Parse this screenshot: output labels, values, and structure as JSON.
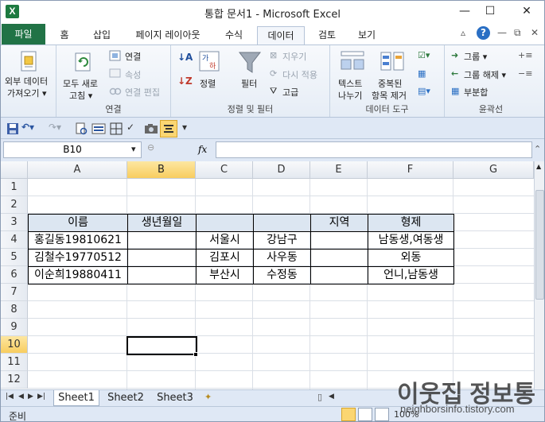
{
  "window": {
    "title": "통합 문서1  -  Microsoft Excel",
    "app_icon_letter": "X",
    "minimize": "—",
    "maximize": "☐",
    "close": "✕"
  },
  "ribbon_tabs": {
    "file": "파일",
    "items": [
      "홈",
      "삽입",
      "페이지 레이아웃",
      "수식",
      "데이터",
      "검토",
      "보기"
    ],
    "active": "데이터"
  },
  "ribbon": {
    "get_external": {
      "line1": "외부 데이터",
      "line2": "가져오기 ▾"
    },
    "refresh_all": {
      "line1": "모두 새로",
      "line2": "고침 ▾"
    },
    "connections": "연결",
    "properties": "속성",
    "edit_links": "연결 편집",
    "group_connections": "연결",
    "sort": "정렬",
    "filter": "필터",
    "clear": "지우기",
    "reapply": "다시 적용",
    "advanced": "고급",
    "group_sort_filter": "정렬 및 필터",
    "text_to_columns": {
      "line1": "텍스트",
      "line2": "나누기"
    },
    "remove_duplicates": {
      "line1": "중복된",
      "line2": "항목 제거"
    },
    "group_data_tools": "데이터 도구",
    "group": "그룹 ▾",
    "ungroup": "그룹 해제 ▾",
    "subtotal": "부분합",
    "group_outline": "윤곽선"
  },
  "formula_bar": {
    "name_box": "B10",
    "fx": "fx",
    "value": ""
  },
  "sheet": {
    "columns": [
      "A",
      "B",
      "C",
      "D",
      "E",
      "F",
      "G"
    ],
    "selected_column": "B",
    "rows": [
      "1",
      "2",
      "3",
      "4",
      "5",
      "6",
      "7",
      "8",
      "9",
      "10",
      "11",
      "12"
    ],
    "selected_row": "10",
    "header_row": [
      "이름",
      "생년월일",
      "",
      "",
      "지역",
      "형제"
    ],
    "data_rows": [
      [
        "홍길동19810621",
        "",
        "서울시",
        "강남구",
        "",
        "남동생,여동생"
      ],
      [
        "김철수19770512",
        "",
        "김포시",
        "사우동",
        "",
        "외동"
      ],
      [
        "이순희19880411",
        "",
        "부산시",
        "수정동",
        "",
        "언니,남동생"
      ]
    ]
  },
  "sheet_tabs": [
    "Sheet1",
    "Sheet2",
    "Sheet3"
  ],
  "active_sheet": "Sheet1",
  "status": {
    "ready": "준비",
    "zoom": "100%"
  },
  "watermark": {
    "title": "이웃집 정보통",
    "url": "neighborsinfo.tistory.com"
  }
}
